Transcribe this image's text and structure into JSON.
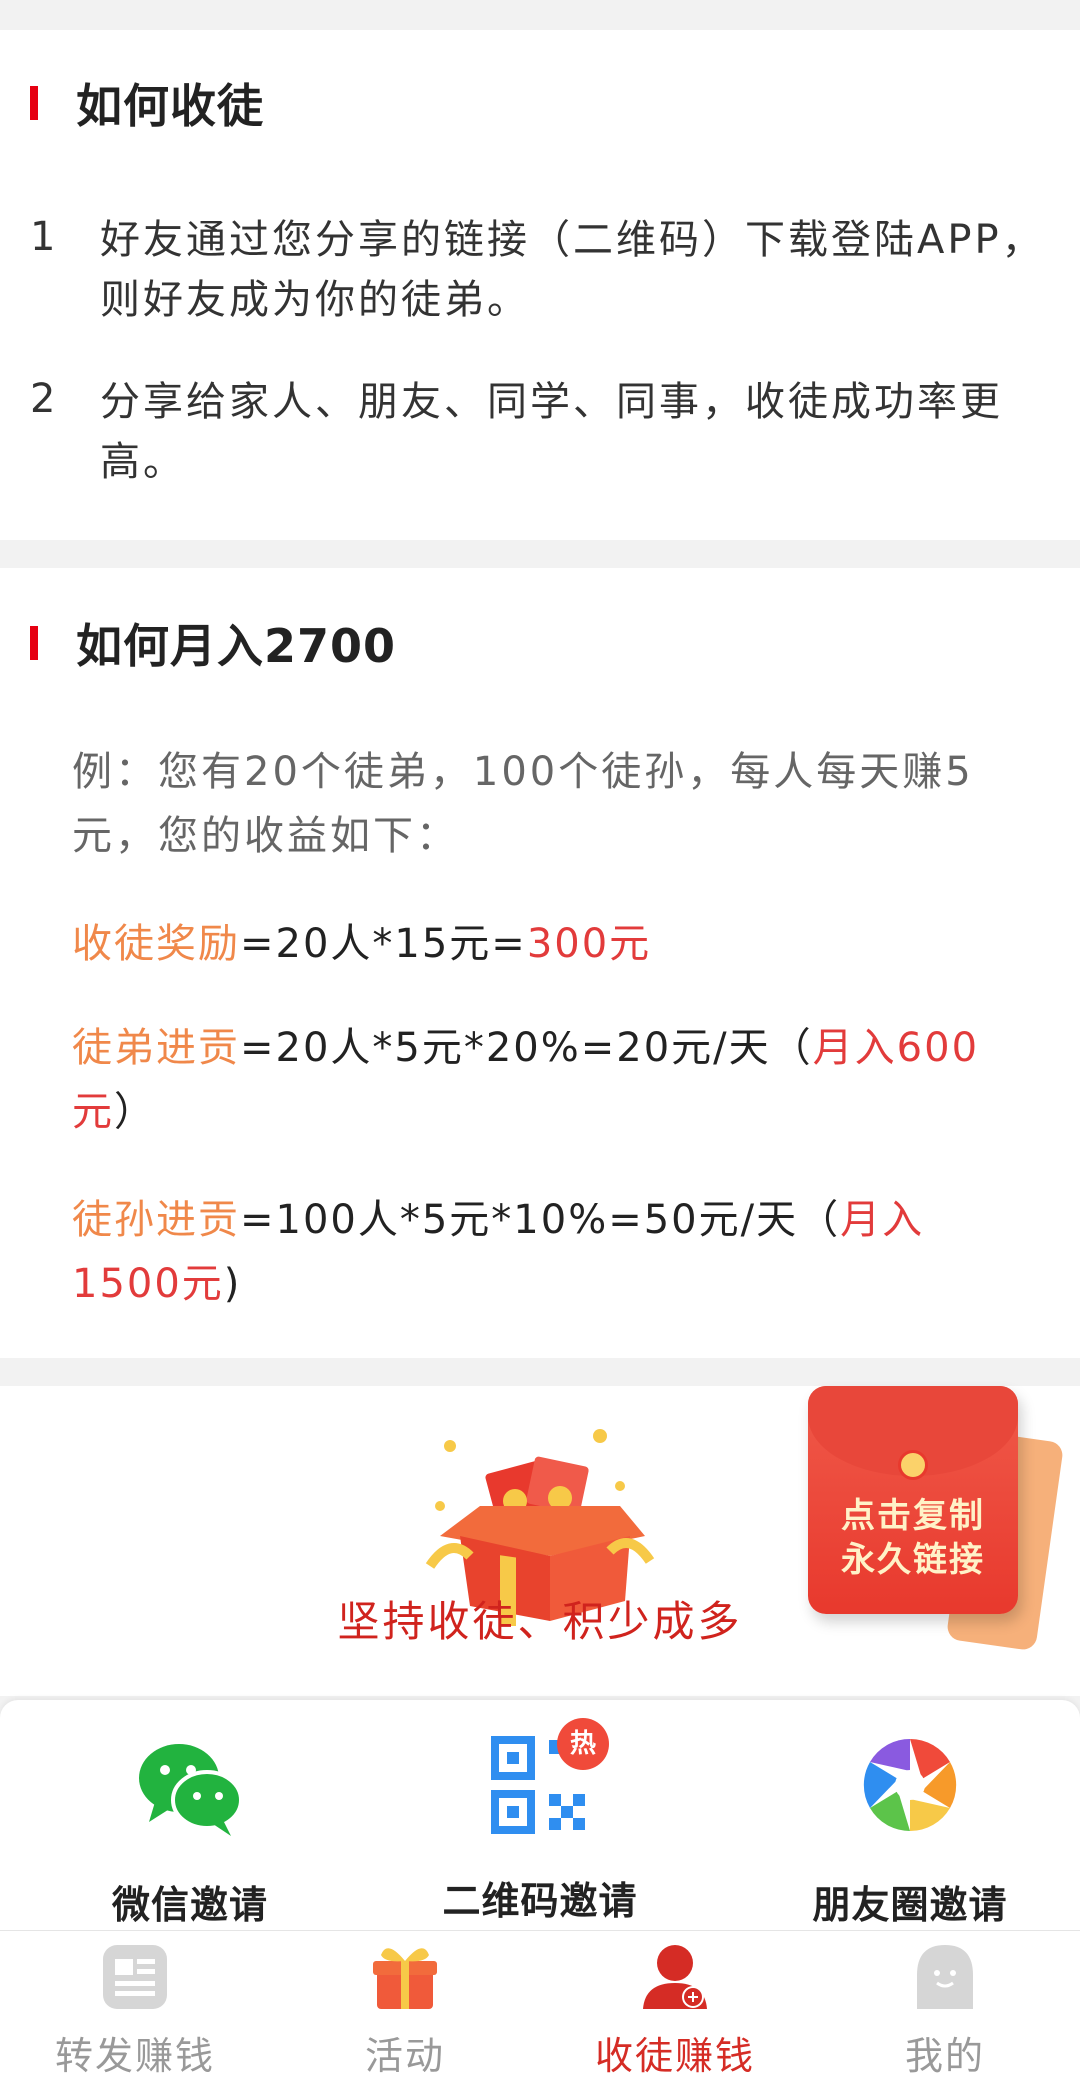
{
  "section1": {
    "title": "如何收徒",
    "steps": [
      {
        "num": "1",
        "text": "好友通过您分享的链接（二维码）下载登陆APP，则好友成为你的徒弟。"
      },
      {
        "num": "2",
        "text": "分享给家人、朋友、同学、同事，收徒成功率更高。"
      }
    ]
  },
  "section2": {
    "title": "如何月入2700",
    "example": "例：您有20个徒弟，100个徒孙，每人每天赚5元，您的收益如下：",
    "formulas": [
      {
        "label": "收徒奖励",
        "expr": "=20人*15元=",
        "highlight": "300元",
        "suffix": ""
      },
      {
        "label": "徒弟进贡",
        "expr": "=20人*5元*20%=20元/天（",
        "highlight": "月入600元",
        "suffix": "）"
      },
      {
        "label": "徒孙进贡",
        "expr": "=100人*5元*10%=50元/天（",
        "highlight": "月入1500元",
        "suffix": ")"
      }
    ]
  },
  "promo": {
    "slogan": "坚持收徒、积少成多",
    "envelope_line1": "点击复制",
    "envelope_line2": "永久链接"
  },
  "share": {
    "items": [
      {
        "label": "微信邀请",
        "icon": "wechat-icon"
      },
      {
        "label": "二维码邀请",
        "icon": "qrcode-icon",
        "badge": "热"
      },
      {
        "label": "朋友圈邀请",
        "icon": "moments-icon"
      }
    ]
  },
  "nav": {
    "items": [
      {
        "label": "转发赚钱",
        "icon": "news-icon",
        "active": false
      },
      {
        "label": "活动",
        "icon": "gift-icon",
        "active": false
      },
      {
        "label": "收徒赚钱",
        "icon": "user-add-icon",
        "active": true
      },
      {
        "label": "我的",
        "icon": "profile-icon",
        "active": false
      }
    ]
  },
  "colors": {
    "accent_red": "#e60012",
    "highlight_red": "#e23b3b",
    "orange": "#f0884a",
    "nav_active": "#d52c25",
    "nav_inactive": "#999999"
  }
}
